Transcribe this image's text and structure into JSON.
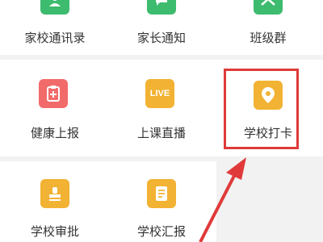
{
  "grid": {
    "row1": [
      {
        "label": "家校通讯录",
        "icon": "contacts-icon",
        "color": "#3dbb6e"
      },
      {
        "label": "家长通知",
        "icon": "chat-icon",
        "color": "#3dbb6e"
      },
      {
        "label": "班级群",
        "icon": "group-icon",
        "color": "#3dbb6e"
      }
    ],
    "row2": [
      {
        "label": "健康上报",
        "icon": "health-clipboard-icon",
        "color": "#f26b6b"
      },
      {
        "label": "上课直播",
        "icon": "live-icon",
        "icon_text": "LIVE",
        "color": "#f2b233"
      },
      {
        "label": "学校打卡",
        "icon": "location-pin-icon",
        "color": "#f2b233"
      }
    ],
    "row3": [
      {
        "label": "学校审批",
        "icon": "approval-stamp-icon",
        "color": "#f2b233"
      },
      {
        "label": "学校汇报",
        "icon": "report-document-icon",
        "color": "#f2b233"
      }
    ]
  },
  "highlight": {
    "target": "学校打卡",
    "box_color": "#e03a3a",
    "arrow_color": "#e03a3a"
  }
}
